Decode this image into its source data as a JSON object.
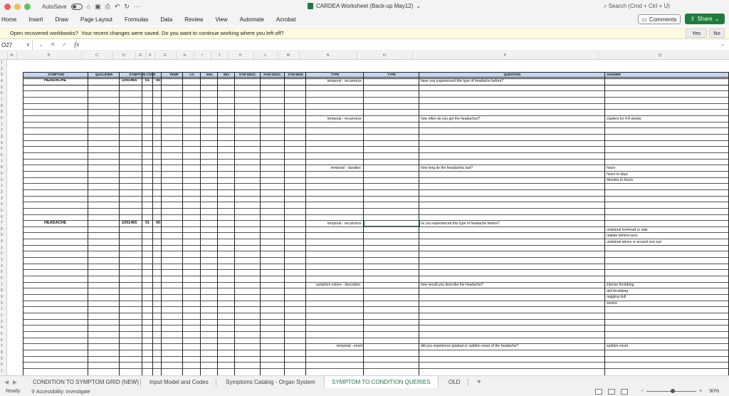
{
  "titlebar": {
    "autosave_label": "AutoSave",
    "more": "···",
    "doc_title": "CARDEA Worksheet (Back-up May12)",
    "search_placeholder": "Search (Cmd + Ctrl + U)"
  },
  "ribbon": {
    "tabs": [
      "Home",
      "Insert",
      "Draw",
      "Page Layout",
      "Formulas",
      "Data",
      "Review",
      "View",
      "Automate",
      "Acrobat"
    ],
    "comments_label": "Comments",
    "share_label": "Share"
  },
  "message_bar": {
    "title": "Open recovered workbooks?",
    "text": "Your recent changes were saved. Do you want to continue working where you left off?",
    "yes_label": "Yes",
    "no_label": "No"
  },
  "formula_bar": {
    "name_box": "O27",
    "fx": "fx",
    "value": ""
  },
  "columns": [
    "A",
    "B",
    "C",
    "D",
    "E",
    "F",
    "G",
    "H",
    "I",
    "J",
    "K",
    "L",
    "M",
    "N",
    "O",
    "P",
    "Q"
  ],
  "selected_column": "O",
  "table_headers": {
    "symptom": "SYMPTOM",
    "qualifier": "QUALIFIER",
    "symptom_code": "SYMPTOM CODE",
    "temp": "TEMP",
    "lo": "LO",
    "ana": "ANA",
    "sev": "SEV",
    "sym_desc": "SYM DESC.",
    "pain_desc": "PAIN DESC.",
    "sym_mod": "SYM MOD",
    "type_n": "TYPE",
    "type_o": "TYPE",
    "question": "QUESTION",
    "answer": "ANSWER"
  },
  "blocks": [
    {
      "symptom": "HEADACHE",
      "code": "1001465",
      "e": "01",
      "f": "00"
    },
    {
      "symptom": "HEADACHE",
      "code": "1001465",
      "e": "01",
      "f": "00"
    }
  ],
  "entries": [
    {
      "type": "temporal - recurrence",
      "question": "have you experienced this type of headache before?",
      "answers": []
    },
    {
      "type": "temporal - recurrence",
      "question": "how often do you get the headaches?",
      "answers": [
        "clusters for 4-8 weeks"
      ]
    },
    {
      "type": "temporal - duration",
      "question": "how long do the headaches last?",
      "answers": [
        "hours",
        "hours to days",
        "minutes to hours"
      ]
    },
    {
      "type": "temporal - recurrence",
      "question": "ve you experienced this type of headache before?",
      "answers": [
        "unilateral forehead or side",
        "radiate behind eyes",
        "unilateral above or around one eye"
      ]
    },
    {
      "type": "symptom nature - descriptor",
      "question": "how would you describe the headache?",
      "answers": [
        "intense throbbing",
        "dull throbbing",
        "nagging dull",
        "severe"
      ]
    },
    {
      "type": "temporal - onset",
      "question": "did you experience gradual or sudden onset of the headache?",
      "answers": [
        "sudden onset"
      ]
    }
  ],
  "sheet_tabs": [
    "CONDITION TO SYMPTOM GRID (NEW)",
    "Input Model and Codes",
    "Symptoms Catalog - Organ System",
    "SYMPTOM TO CONDITION QUERIES",
    "OLD"
  ],
  "active_tab": "SYMPTOM TO CONDITION QUERIES",
  "add_sheet": "+",
  "status": {
    "ready": "Ready",
    "accessibility": "Accessibility: Investigate",
    "zoom_minus": "−",
    "zoom_plus": "+",
    "zoom_level": "90%"
  },
  "colors": {
    "accent_green": "#1e7d3e",
    "header_blue": "#c9d4ec",
    "message_bg": "#fdf8e0"
  }
}
